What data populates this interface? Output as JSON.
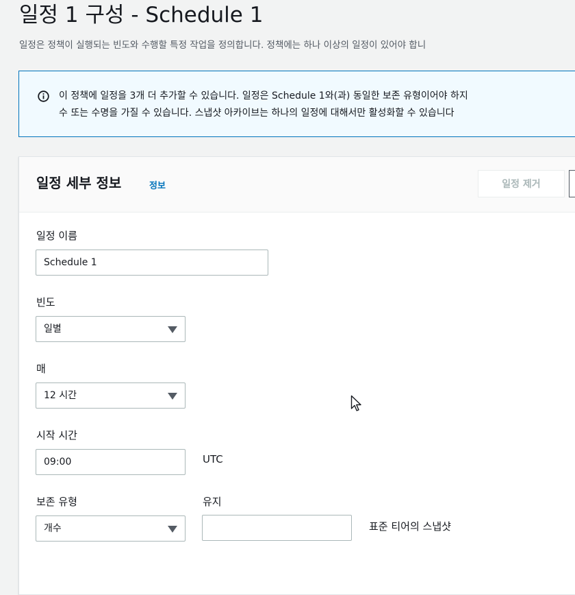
{
  "page": {
    "title": "일정 1 구성 - Schedule 1",
    "description": "일정은 정책이 실행되는 빈도와 수행할 특정 작업을 정의합니다. 정책에는 하나 이상의 일정이 있어야 합니"
  },
  "alert": {
    "icon": "info-circle-icon",
    "line1": "이 정책에 일정을 3개 더 추가할 수 있습니다. 일정은 Schedule 1와(과) 동일한 보존 유형이어야 하지",
    "line2": "수 또는 수명을 가질 수 있습니다. 스냅샷 아카이브는 하나의 일정에 대해서만 활성화할 수 있습니다"
  },
  "panel": {
    "title": "일정 세부 정보",
    "info_link": "정보",
    "remove_button": "일정 제거"
  },
  "form": {
    "schedule_name": {
      "label": "일정 이름",
      "value": "Schedule 1"
    },
    "frequency": {
      "label": "빈도",
      "value": "일별"
    },
    "every": {
      "label": "매",
      "value": "12 시간"
    },
    "start_time": {
      "label": "시작 시간",
      "value": "09:00",
      "suffix": "UTC"
    },
    "retention_type": {
      "label": "보존 유형",
      "value": "개수"
    },
    "retain": {
      "label": "유지",
      "value": "",
      "suffix": "표준 티어의 스냅샷"
    }
  },
  "colors": {
    "link": "#0073bb",
    "alert_border": "#0073bb",
    "alert_bg": "#f1faff"
  }
}
